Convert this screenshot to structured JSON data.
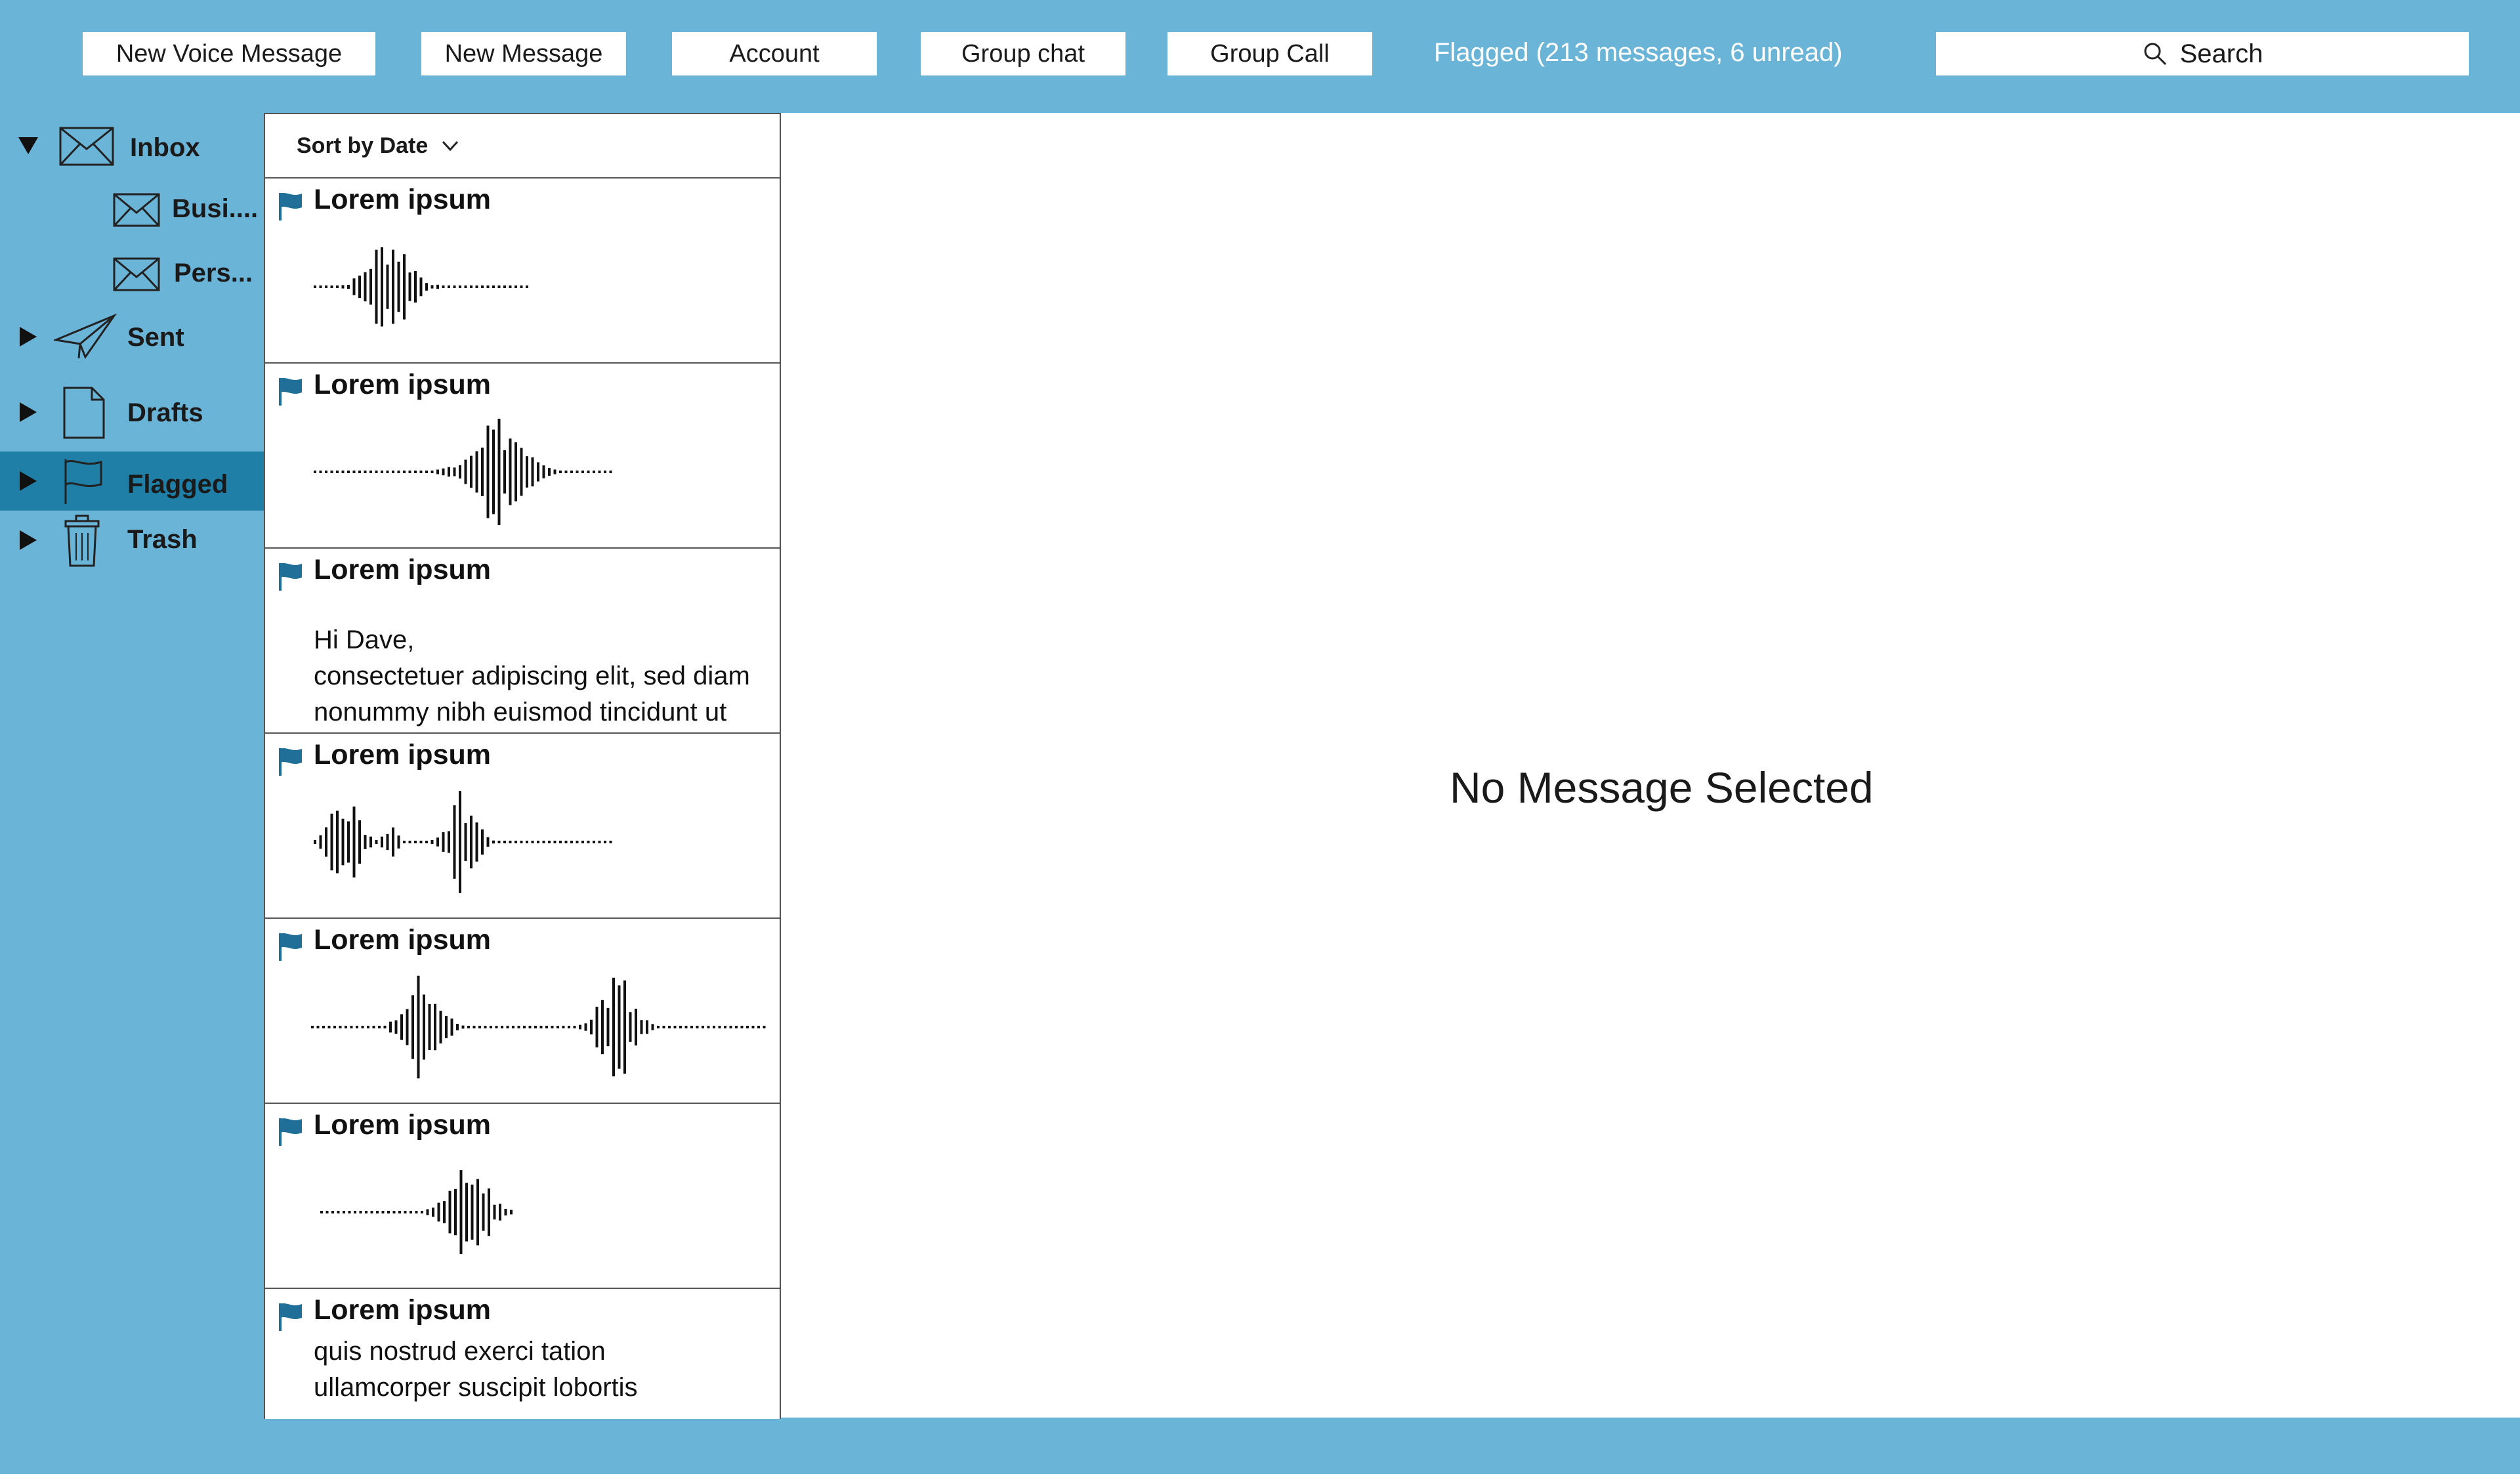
{
  "toolbar": {
    "new_voice_message": "New  Voice Message",
    "new_message": "New Message",
    "account": "Account",
    "group_chat": "Group chat",
    "group_call": "Group Call",
    "status": "Flagged (213 messages, 6 unread)",
    "search_label": "Search"
  },
  "sidebar": {
    "items": [
      {
        "label": "Inbox",
        "icon": "envelope-icon"
      },
      {
        "label": "Busi....",
        "icon": "envelope-icon"
      },
      {
        "label": "Pers...",
        "icon": "envelope-icon"
      },
      {
        "label": "Sent",
        "icon": "paper-plane-icon"
      },
      {
        "label": "Drafts",
        "icon": "document-icon"
      },
      {
        "label": "Flagged",
        "icon": "flag-icon"
      },
      {
        "label": "Trash",
        "icon": "trash-icon"
      }
    ],
    "active": "Flagged"
  },
  "list": {
    "sort_label": "Sort by Date",
    "messages": [
      {
        "title": "Lorem ipsum",
        "type": "voice"
      },
      {
        "title": "Lorem ipsum",
        "type": "voice"
      },
      {
        "title": "Lorem ipsum",
        "type": "text",
        "body_lines": [
          "Hi Dave,",
          "consectetuer adipiscing elit, sed diam",
          "nonummy nibh euismod tincidunt ut"
        ]
      },
      {
        "title": "Lorem ipsum",
        "type": "voice"
      },
      {
        "title": "Lorem ipsum",
        "type": "voice"
      },
      {
        "title": "Lorem ipsum",
        "type": "voice"
      },
      {
        "title": "Lorem ipsum",
        "type": "text",
        "body_lines": [
          "quis nostrud exerci tation",
          "ullamcorper suscipit lobortis"
        ]
      }
    ]
  },
  "preview": {
    "empty_text": "No Message Selected"
  },
  "colors": {
    "background": "#6ab4d8",
    "active_item": "#1f7fa6",
    "flag": "#1f6f99"
  }
}
